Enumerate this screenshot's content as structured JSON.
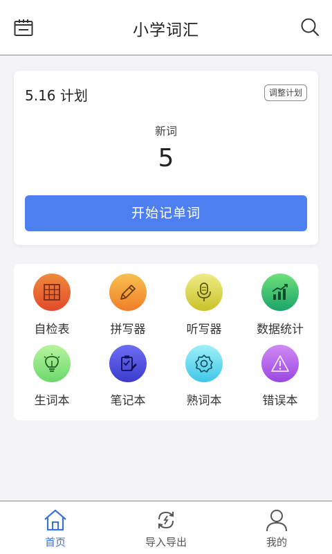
{
  "header": {
    "title": "小学词汇",
    "left_icon": "calendar-icon",
    "right_icon": "search-icon"
  },
  "plan": {
    "title": "5.16 计划",
    "adjust_label": "调整计划",
    "new_words_label": "新词",
    "new_words_count": "5",
    "start_label": "开始记单词"
  },
  "tools": [
    {
      "label": "自检表",
      "icon": "grid-table-icon",
      "color_top": "#f08a3c",
      "color_bottom": "#e24a2a"
    },
    {
      "label": "拼写器",
      "icon": "pencil-icon",
      "color_top": "#f8c050",
      "color_bottom": "#f07e28"
    },
    {
      "label": "听写器",
      "icon": "microphone-icon",
      "color_top": "#eeec86",
      "color_bottom": "#c9c22a"
    },
    {
      "label": "数据统计",
      "icon": "bar-chart-icon",
      "color_top": "#6ee07a",
      "color_bottom": "#1aa56a"
    },
    {
      "label": "生词本",
      "icon": "lightbulb-icon",
      "color_top": "#b8f4a0",
      "color_bottom": "#6bd86b"
    },
    {
      "label": "笔记本",
      "icon": "clipboard-pen-icon",
      "color_top": "#6b6ef4",
      "color_bottom": "#3b3ccc"
    },
    {
      "label": "熟词本",
      "icon": "gear-icon",
      "color_top": "#9ef0f8",
      "color_bottom": "#40c6e8"
    },
    {
      "label": "错误本",
      "icon": "warning-icon",
      "color_top": "#d08af4",
      "color_bottom": "#9b46e2"
    }
  ],
  "tabbar": {
    "items": [
      {
        "label": "首页",
        "icon": "home-icon",
        "active": true
      },
      {
        "label": "导入导出",
        "icon": "sync-arrows-icon",
        "active": false
      },
      {
        "label": "我的",
        "icon": "user-icon",
        "active": false
      }
    ],
    "active_color": "#3a74d8"
  },
  "colors": {
    "primary_button": "#4d7ff0",
    "background": "#f4f4f6"
  }
}
